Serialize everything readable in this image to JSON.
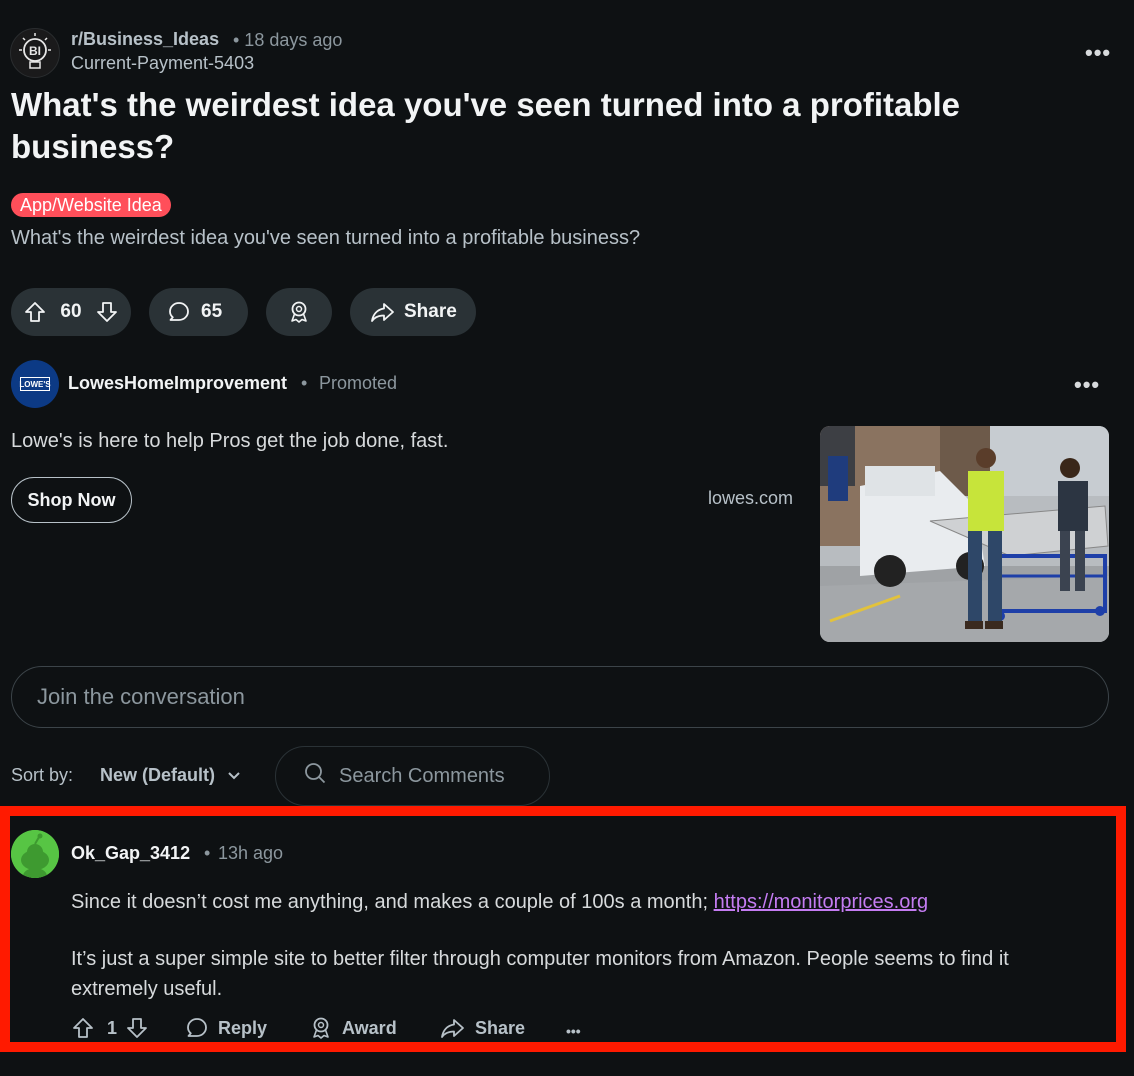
{
  "post": {
    "subreddit": "r/Business_Ideas",
    "meta": "• 18 days ago",
    "author": "Current-Payment-5403",
    "subreddit_icon_text": "BI",
    "title": "What's the weirdest idea you've seen turned into a profitable business?",
    "flair": "App/Website Idea",
    "body": "What's the weirdest idea you've seen turned into a profitable business?",
    "votes": "60",
    "comments": "65",
    "share_label": "Share",
    "more": "•••"
  },
  "ad": {
    "advertiser": "LowesHomeImprovement",
    "dot": "•",
    "promoted": "Promoted",
    "logo_text": "LOWE'S",
    "text": "Lowe's is here to help Pros get the job done, fast.",
    "cta": "Shop Now",
    "domain": "lowes.com",
    "more": "•••"
  },
  "composer": {
    "placeholder": "Join the conversation"
  },
  "sort": {
    "label": "Sort by:",
    "value": "New (Default)",
    "search_placeholder": "Search Comments"
  },
  "comment": {
    "username": "Ok_Gap_3412",
    "dot": "•",
    "time": "13h ago",
    "p1_text": "Since it doesn’t cost me anything, and makes a couple of 100s a month; ",
    "p1_link": "https://monitorprices.org",
    "p2": "It’s just a super simple site to better filter through computer monitors from Amazon. People seems to find it extremely useful.",
    "votes": "1",
    "reply": "Reply",
    "award": "Award",
    "share": "Share",
    "more": "•••"
  },
  "colors": {
    "background": "#0e1113",
    "pill": "#2a3236",
    "flair": "#ff4f5a",
    "highlight": "#ff1a00",
    "link": "#c47cf2",
    "comment_avatar": "#57c544"
  }
}
